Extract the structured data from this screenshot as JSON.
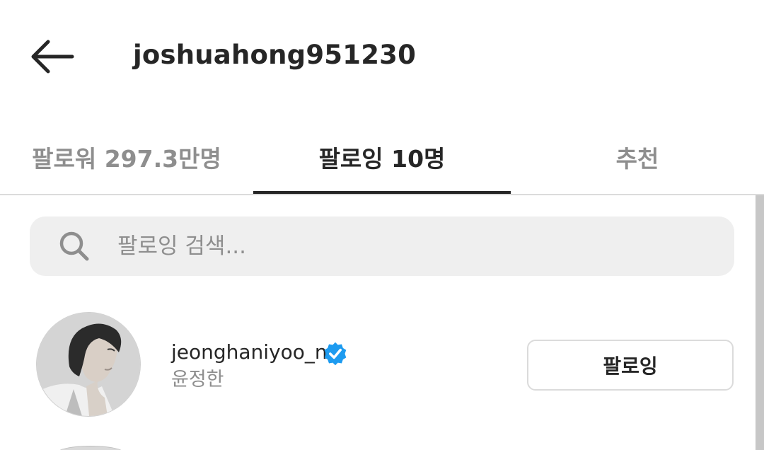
{
  "header": {
    "back_icon": "arrow-left-icon",
    "title": "joshuahong951230"
  },
  "tabs": [
    {
      "label": "팔로워 297.3만명",
      "active": false
    },
    {
      "label": "팔로잉 10명",
      "active": true
    },
    {
      "label": "추천",
      "active": false
    }
  ],
  "search": {
    "icon": "search-icon",
    "placeholder": "팔로잉 검색...",
    "value": ""
  },
  "following_list": [
    {
      "username": "jeonghaniyoo_n",
      "verified": true,
      "full_name": "윤정한",
      "button_label": "팔로잉"
    }
  ],
  "colors": {
    "primary_text": "#262626",
    "secondary_text": "#8e8e8e",
    "verified_blue": "#1D9BF0",
    "search_background": "#efefef",
    "divider": "#dbdbdb"
  }
}
